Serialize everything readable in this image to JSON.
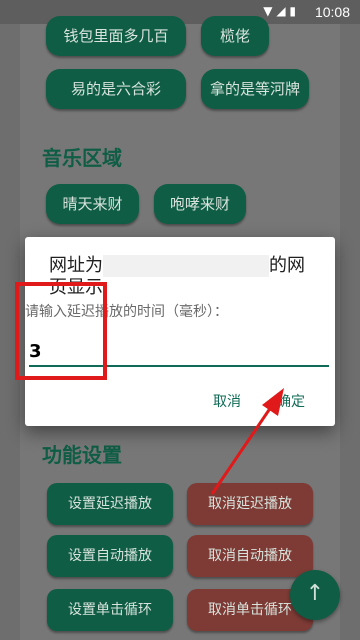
{
  "status_bar": {
    "time": "10:08",
    "icons": [
      "wifi-icon",
      "signal-icon",
      "battery-icon"
    ]
  },
  "chips": [
    {
      "label": "钱包里面多几百"
    },
    {
      "label": "榄佬"
    },
    {
      "label": "易的是六合彩"
    },
    {
      "label": "拿的是等河牌"
    }
  ],
  "music_section": {
    "title": "音乐区域",
    "chips": [
      {
        "label": "晴天来财"
      },
      {
        "label": "咆哮来财"
      }
    ]
  },
  "function_section": {
    "title": "功能设置",
    "buttons": [
      {
        "label": "设置延迟播放",
        "color": "#0f5d45"
      },
      {
        "label": "取消延迟播放",
        "color": "#7e3b36"
      },
      {
        "label": "设置自动播放",
        "color": "#0f5d45"
      },
      {
        "label": "取消自动播放",
        "color": "#7e3b36"
      },
      {
        "label": "设置单击循环",
        "color": "#0f5d45"
      },
      {
        "label": "取消单击循环",
        "color": "#7e3b36"
      }
    ]
  },
  "fab": {
    "icon": "arrow-up-icon",
    "glyph": "↑"
  },
  "dialog": {
    "title_prefix": "网址为",
    "title_suffix": "的网页显示:",
    "message": "请输入延迟播放的时间（毫秒）：",
    "input_value": "3",
    "cancel_label": "取消",
    "ok_label": "确定"
  },
  "colors": {
    "accent": "#0f6b55",
    "chip_bg": "#0f5d45",
    "cancel_bg": "#7e3b36",
    "annotation": "#e01a1a"
  }
}
